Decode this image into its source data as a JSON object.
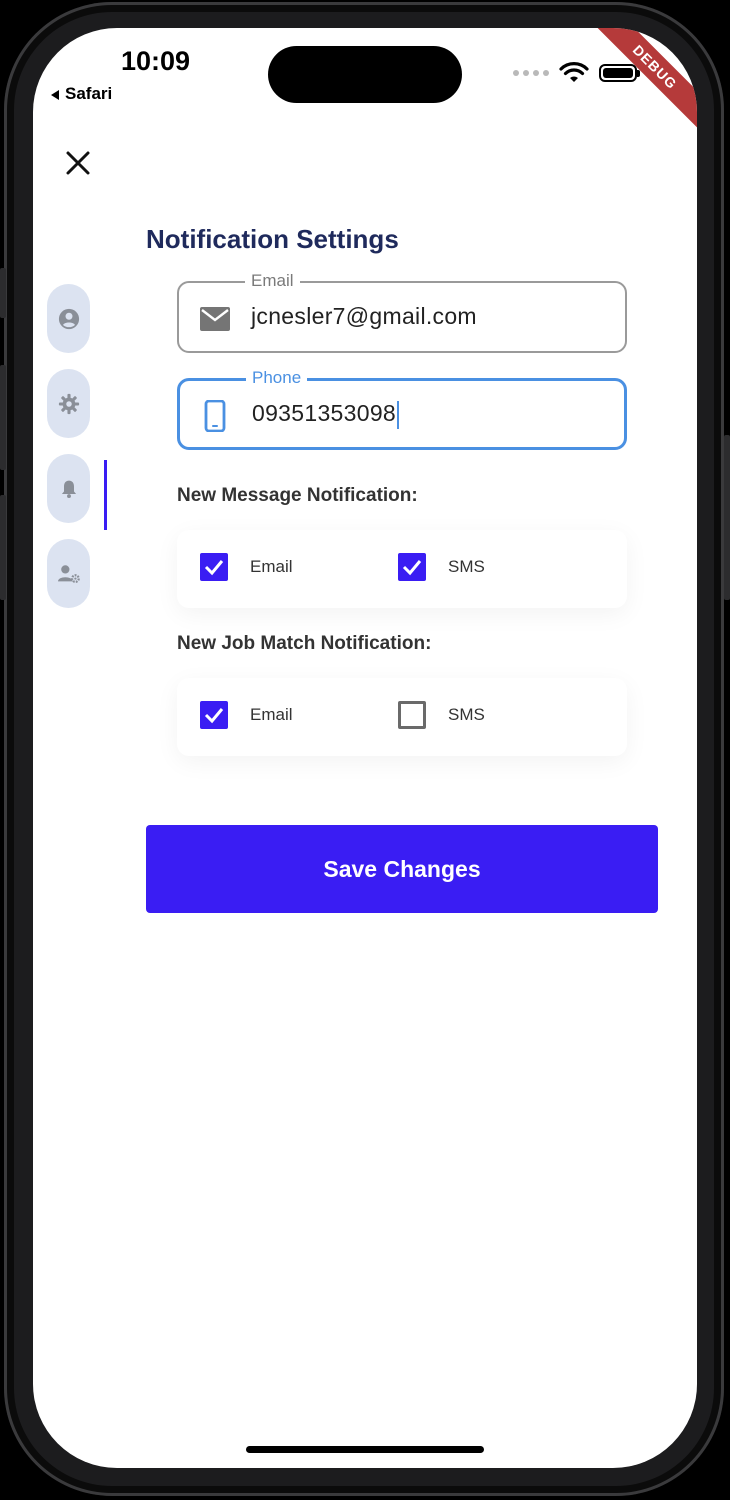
{
  "status_bar": {
    "time": "10:09",
    "back_app": "Safari",
    "debug_label": "DEBUG"
  },
  "page": {
    "title": "Notification Settings"
  },
  "side_rail": {
    "items": [
      {
        "icon": "account-circle-icon"
      },
      {
        "icon": "gear-icon"
      },
      {
        "icon": "bell-icon",
        "selected": true
      },
      {
        "icon": "user-settings-icon"
      }
    ]
  },
  "form": {
    "email": {
      "label": "Email",
      "value": "jcnesler7@gmail.com",
      "icon": "mail-icon"
    },
    "phone": {
      "label": "Phone",
      "value": "09351353098",
      "icon": "phone-icon"
    }
  },
  "new_message": {
    "label": "New Message Notification:",
    "options": [
      {
        "label": "Email",
        "checked": true
      },
      {
        "label": "SMS",
        "checked": true
      }
    ]
  },
  "new_job_match": {
    "label": "New Job Match Notification:",
    "options": [
      {
        "label": "Email",
        "checked": true
      },
      {
        "label": "SMS",
        "checked": false
      }
    ]
  },
  "actions": {
    "save_label": "Save Changes"
  },
  "colors": {
    "accent": "#3A1DF3",
    "focus": "#4A90E2",
    "title": "#1F2A5C",
    "rail_bg": "#DCE3F1",
    "debug": "#B53A3A"
  }
}
